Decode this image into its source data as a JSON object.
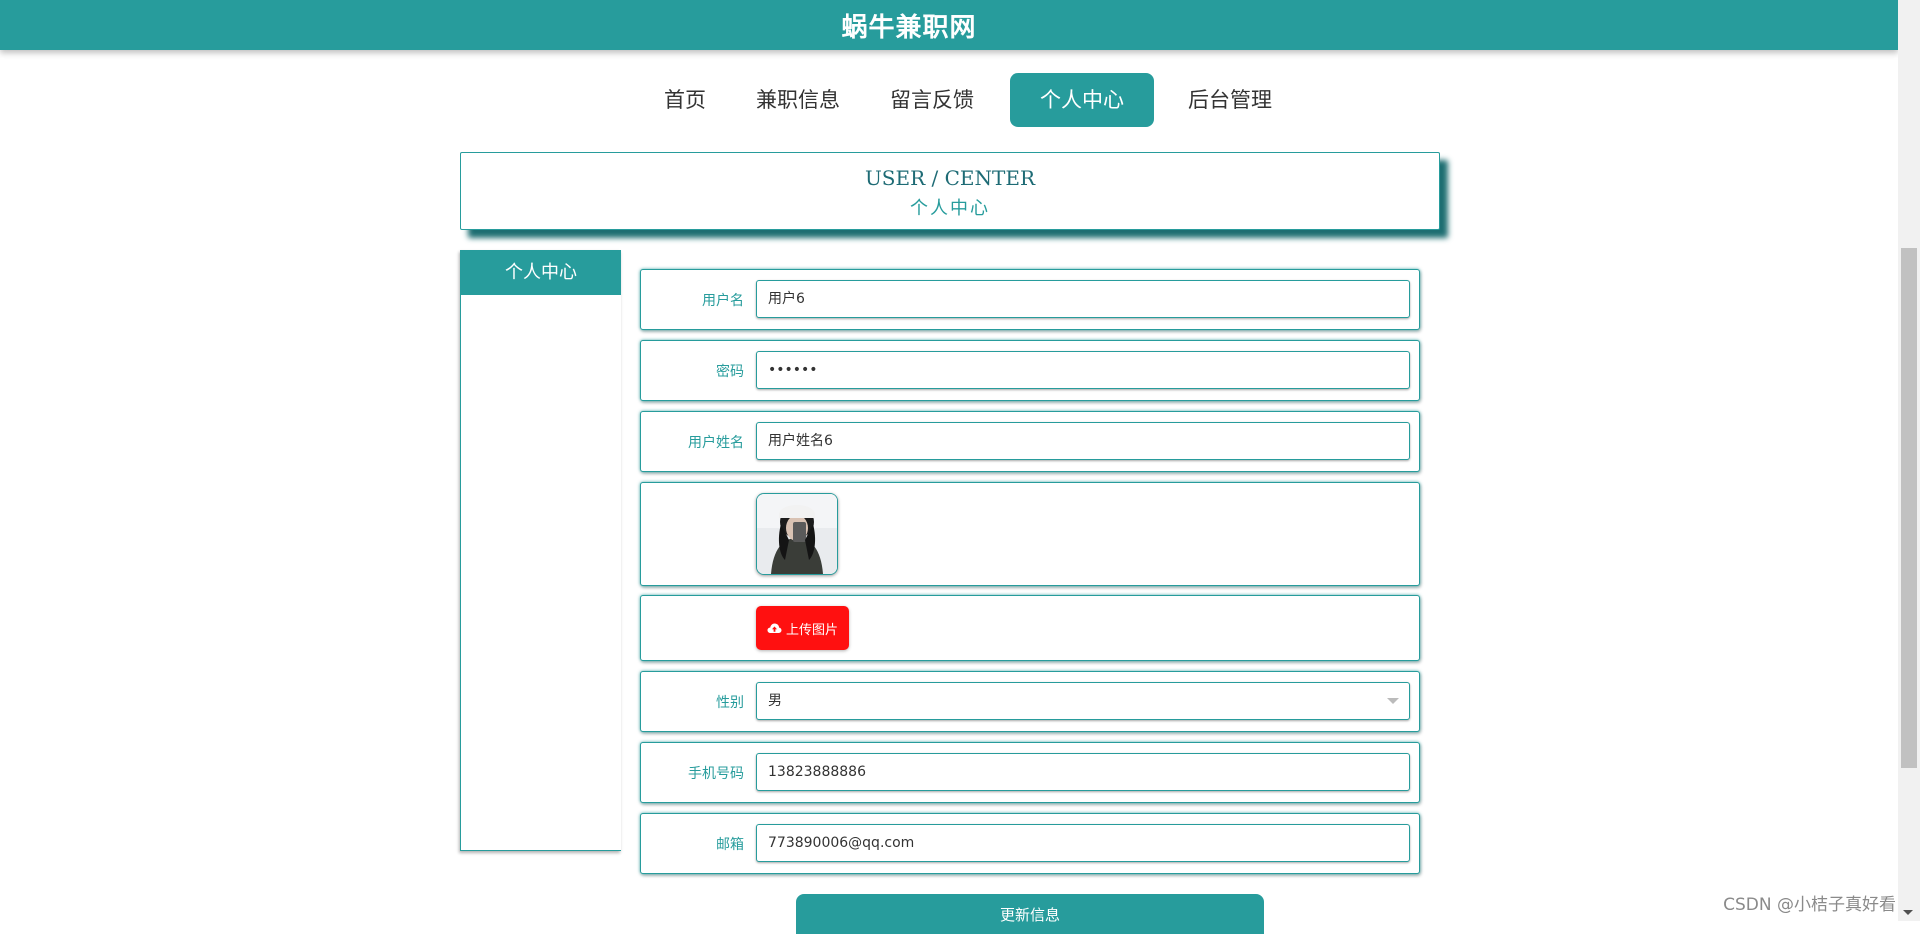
{
  "header": {
    "site_title": "蜗牛兼职网"
  },
  "nav": {
    "items": [
      {
        "label": "首页",
        "active": false
      },
      {
        "label": "兼职信息",
        "active": false
      },
      {
        "label": "留言反馈",
        "active": false
      },
      {
        "label": "个人中心",
        "active": true
      },
      {
        "label": "后台管理",
        "active": false
      }
    ]
  },
  "banner": {
    "title_en": "USER / CENTER",
    "title_cn": "个人中心"
  },
  "sidebar": {
    "title": "个人中心"
  },
  "form": {
    "username_label": "用户名",
    "username_value": "用户6",
    "password_label": "密码",
    "password_value": "••••••",
    "realname_label": "用户姓名",
    "realname_value": "用户姓名6",
    "upload_button": "上传图片",
    "gender_label": "性别",
    "gender_value": "男",
    "phone_label": "手机号码",
    "phone_value": "13823888886",
    "email_label": "邮箱",
    "email_value": "773890006@qq.com",
    "update_button": "更新信息"
  },
  "watermark": "CSDN @小桔子真好看",
  "colors": {
    "accent": "#279c9c",
    "upload": "#ff1010",
    "label": "#279c9c"
  },
  "icons": {
    "upload": "cloud-upload-icon",
    "select": "chevron-down-icon"
  }
}
